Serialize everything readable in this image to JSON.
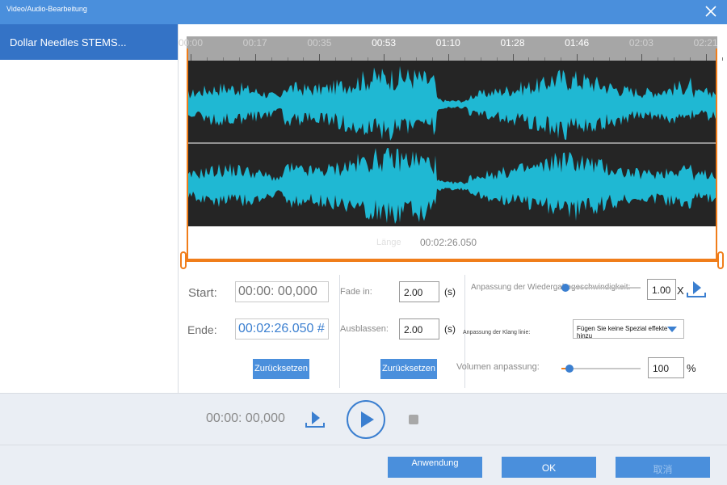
{
  "window": {
    "title": "Video/Audio-Bearbeitung",
    "close_icon": "close-icon"
  },
  "sidebar": {
    "items": [
      {
        "label": "Dollar Needles STEMS..."
      }
    ]
  },
  "timeline": {
    "labels": [
      {
        "text": "00:00",
        "faded": true
      },
      {
        "text": "00:17",
        "faded": true
      },
      {
        "text": "00:35",
        "faded": true
      },
      {
        "text": "00:53",
        "faded": false
      },
      {
        "text": "01:10",
        "faded": false
      },
      {
        "text": "01:28",
        "faded": false
      },
      {
        "text": "01:46",
        "faded": false
      },
      {
        "text": "02:03",
        "faded": true
      },
      {
        "text": "02:21",
        "faded": true
      }
    ]
  },
  "waveform": {
    "color": "#1fb8d3",
    "background": "#252525"
  },
  "duration": {
    "label": "Länge",
    "value": "00:02:26.050"
  },
  "trim": {
    "start_label": "Start:",
    "start_value": "00:00: 00,000",
    "end_label": "Ende:",
    "end_value": "00:02:26.050 #",
    "reset_label": "Zurücksetzen"
  },
  "fade": {
    "fade_in_label": "Fade in:",
    "fade_in_value": "2.00",
    "fade_out_label": "Ausblassen:",
    "fade_out_value": "2.00",
    "unit": "(s)",
    "reset_label": "Zurücksetzen"
  },
  "effects": {
    "speed_label": "Anpassung der Wiedergabegeschwindigkeit:",
    "speed_value": "1.00",
    "speed_unit": "X",
    "speed_level": 0.05,
    "apply_speed_icon": "download-icon",
    "sound_label": "Anpassung der Klang linie:",
    "sound_option": "Fügen Sie keine Spezial effekte hinzu",
    "volume_label": "Volumen anpassung:",
    "volume_value": "100",
    "volume_unit": "%",
    "volume_level": 0.1
  },
  "player": {
    "time": "00:00: 00,000",
    "export_icon": "download-icon",
    "play_icon": "play-icon",
    "stop_icon": "stop-icon"
  },
  "footer": {
    "apply_label": "Anwendung",
    "ok_label": "OK",
    "cancel_label": "取消"
  },
  "colors": {
    "accent": "#4a8fdc",
    "selection": "#3473c6",
    "range": "#f07d1a"
  }
}
